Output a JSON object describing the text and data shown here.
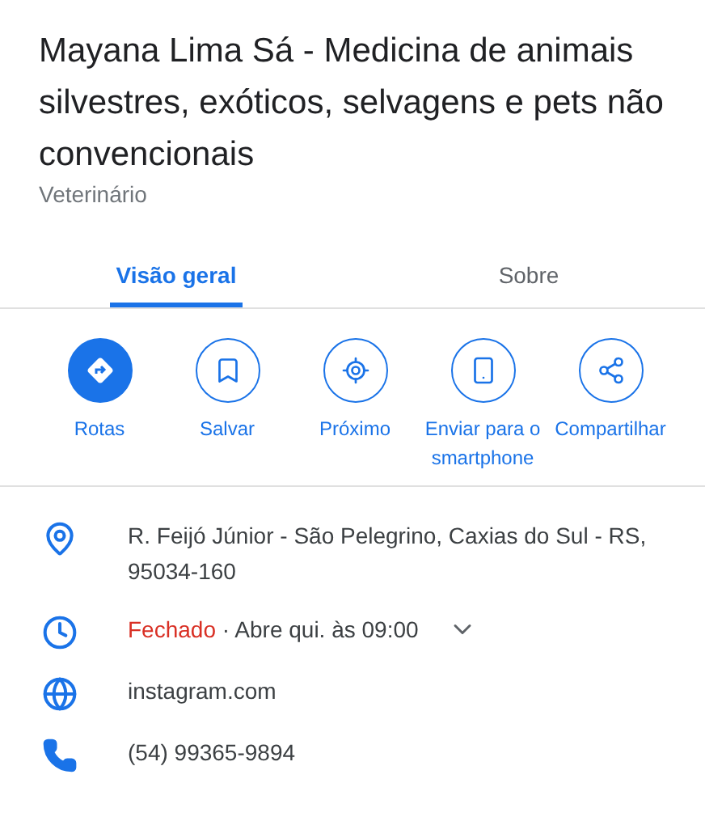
{
  "place": {
    "title": "Mayana Lima Sá - Medicina de animais silvestres, exóticos, selvagens e pets não convencionais",
    "category": "Veterinário"
  },
  "tabs": [
    {
      "label": "Visão geral",
      "selected": true
    },
    {
      "label": "Sobre",
      "selected": false
    }
  ],
  "actions": [
    {
      "kind": "directions",
      "label": "Rotas",
      "filled": true
    },
    {
      "kind": "save",
      "label": "Salvar",
      "filled": false
    },
    {
      "kind": "nearby",
      "label": "Próximo",
      "filled": false
    },
    {
      "kind": "send",
      "label": "Enviar para o smartphone",
      "filled": false
    },
    {
      "kind": "share",
      "label": "Compartilhar",
      "filled": false
    }
  ],
  "info": [
    {
      "kind": "address",
      "text": "R. Feijó Júnior - São Pelegrino, Caxias do Sul - RS, 95034-160"
    },
    {
      "kind": "hours",
      "status": "Fechado",
      "text": "· Abre qui. às 09:00",
      "expanded": false
    },
    {
      "kind": "website",
      "text": "instagram.com"
    },
    {
      "kind": "phone",
      "text": "(54) 99365-9894"
    }
  ]
}
